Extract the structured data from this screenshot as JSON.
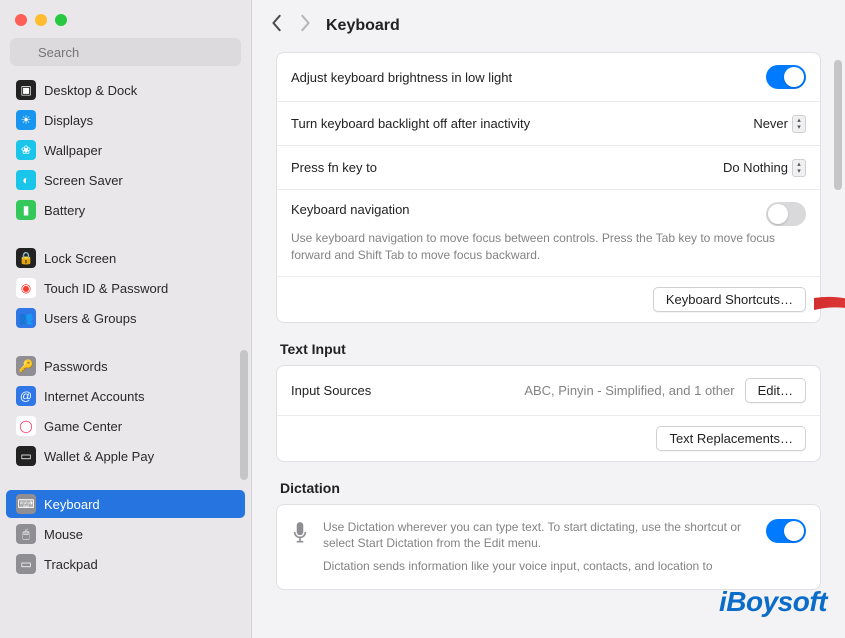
{
  "sidebar": {
    "search_placeholder": "Search",
    "groups": [
      [
        {
          "label": "Desktop & Dock",
          "icon_bg": "#222",
          "icon_glyph": "▣"
        },
        {
          "label": "Displays",
          "icon_bg": "#1796f0",
          "icon_glyph": "☀"
        },
        {
          "label": "Wallpaper",
          "icon_bg": "#19c5e8",
          "icon_glyph": "❀"
        },
        {
          "label": "Screen Saver",
          "icon_bg": "#19c5e8",
          "icon_glyph": "◐"
        },
        {
          "label": "Battery",
          "icon_bg": "#34c759",
          "icon_glyph": "▮"
        }
      ],
      [
        {
          "label": "Lock Screen",
          "icon_bg": "#222",
          "icon_glyph": "🔒"
        },
        {
          "label": "Touch ID & Password",
          "icon_bg": "#fff",
          "icon_glyph": "◉",
          "icon_color": "#ff3b30"
        },
        {
          "label": "Users & Groups",
          "icon_bg": "#2f77e6",
          "icon_glyph": "👥"
        }
      ],
      [
        {
          "label": "Passwords",
          "icon_bg": "#8e8e93",
          "icon_glyph": "🔑"
        },
        {
          "label": "Internet Accounts",
          "icon_bg": "#2f77e6",
          "icon_glyph": "@"
        },
        {
          "label": "Game Center",
          "icon_bg": "#fff",
          "icon_glyph": "◯",
          "icon_color": "#ff2d55"
        },
        {
          "label": "Wallet & Apple Pay",
          "icon_bg": "#222",
          "icon_glyph": "▭"
        }
      ],
      [
        {
          "label": "Keyboard",
          "icon_bg": "#8e8e93",
          "icon_glyph": "⌨",
          "selected": true
        },
        {
          "label": "Mouse",
          "icon_bg": "#8e8e93",
          "icon_glyph": "🖱"
        },
        {
          "label": "Trackpad",
          "icon_bg": "#8e8e93",
          "icon_glyph": "▭"
        }
      ]
    ]
  },
  "header": {
    "title": "Keyboard"
  },
  "keyboard_panel": {
    "brightness_label": "Adjust keyboard brightness in low light",
    "brightness_on": true,
    "backlight_label": "Turn keyboard backlight off after inactivity",
    "backlight_value": "Never",
    "fn_label": "Press fn key to",
    "fn_value": "Do Nothing",
    "nav_label": "Keyboard navigation",
    "nav_desc": "Use keyboard navigation to move focus between controls. Press the Tab key to move focus forward and Shift Tab to move focus backward.",
    "nav_on": false,
    "shortcuts_button": "Keyboard Shortcuts…"
  },
  "text_input": {
    "heading": "Text Input",
    "input_sources_label": "Input Sources",
    "input_sources_value": "ABC, Pinyin - Simplified, and 1 other",
    "edit_button": "Edit…",
    "text_replacements_button": "Text Replacements…"
  },
  "dictation": {
    "heading": "Dictation",
    "desc1": "Use Dictation wherever you can type text. To start dictating, use the shortcut or select Start Dictation from the Edit menu.",
    "desc2": "Dictation sends information like your voice input, contacts, and location to",
    "on": true
  },
  "watermark": "iBoysoft"
}
